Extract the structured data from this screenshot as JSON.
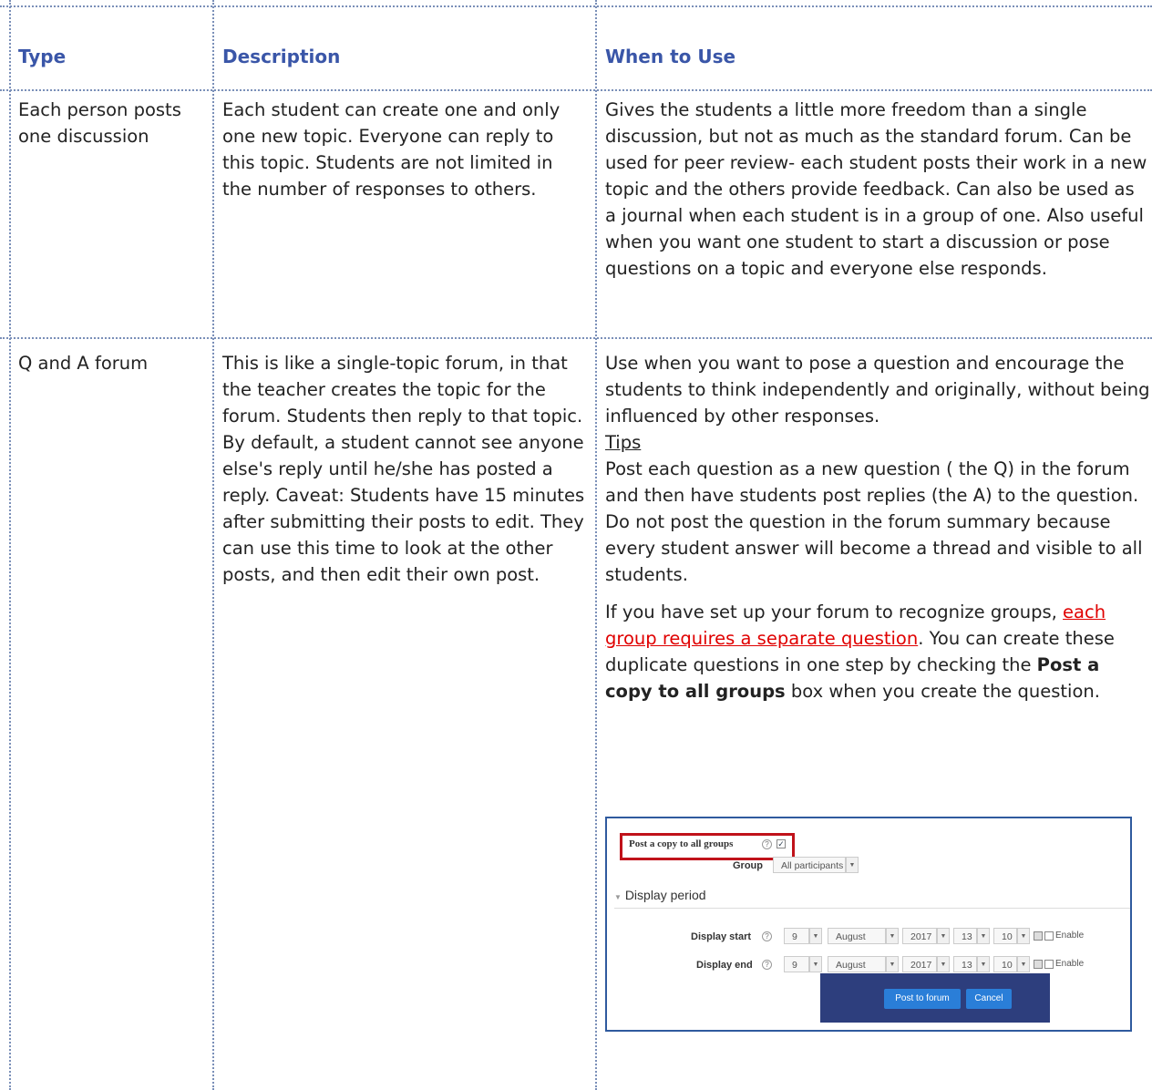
{
  "headers": {
    "type": "Type",
    "description": "Description",
    "when": "When to Use"
  },
  "row1": {
    "type": "Each person posts one discussion",
    "description": "Each student can create one and only one new topic. Everyone can reply to this topic.  Students are not limited in the number of responses to others.",
    "when": "Gives the students a little more freedom than a single discussion, but not as much as the standard forum. Can be used for peer review- each student posts their work in a new topic and the others provide feedback.  Can also be used as a journal when each student is in a group of one. Also useful when you want one student to start a discussion or pose questions on a topic and everyone else responds."
  },
  "row2": {
    "type": "Q and A forum",
    "description": "This is like a single-topic forum, in that the teacher creates the topic for the forum. Students then reply to that topic. By default, a student cannot see anyone else's reply until he/she has posted a reply.  Caveat: Students have 15 minutes after submitting their posts to edit.  They can use this time to look at the other posts, and then edit their own post.",
    "when_p1": "Use when you want to pose a question and encourage the students to think independently and originally, without being influenced by other responses.",
    "tips_label": "Tips",
    "when_p2": "Post each question as a new question ( the Q)  in the forum and then have students post replies (the A) to the question. Do not post the question in the forum summary because every student answer will become a thread and visible to all students.",
    "when_p3_a": "If you have set up your forum to recognize groups, ",
    "when_p3_link": "each group requires a separate question",
    "when_p3_b": ".  You can create these duplicate questions in one step by checking the ",
    "when_p3_bold": "Post a copy to all groups",
    "when_p3_c": " box when you create the question."
  },
  "screenshot": {
    "post_copy_label": "Post a copy to all groups",
    "group_label": "Group",
    "group_value": "All participants",
    "section_title": "Display period",
    "display_start_label": "Display start",
    "display_end_label": "Display end",
    "day": "9",
    "month": "August",
    "year": "2017",
    "hour": "13",
    "minute": "10",
    "enable_label": "Enable",
    "post_button": "Post to forum",
    "cancel_button": "Cancel"
  }
}
